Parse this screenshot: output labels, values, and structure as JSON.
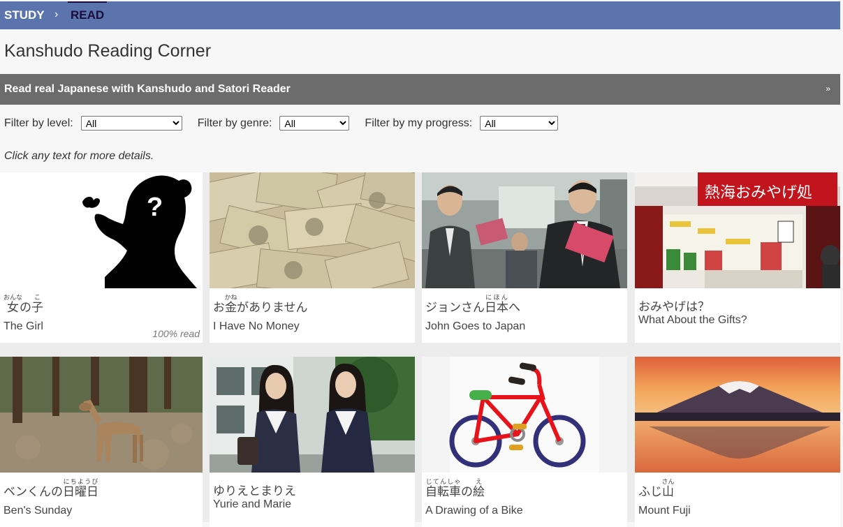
{
  "nav": {
    "study_label": "STUDY",
    "separator": "›",
    "read_label": "READ"
  },
  "page_title": "Kanshudo Reading Corner",
  "banner": {
    "title": "Read real Japanese with Kanshudo and Satori Reader",
    "chevron": "»"
  },
  "filters": {
    "level_label": "Filter by level:",
    "level_value": "All",
    "genre_label": "Filter by genre:",
    "genre_value": "All",
    "progress_label": "Filter by my progress:",
    "progress_value": "All"
  },
  "hint": "Click any text for more details.",
  "cards": [
    {
      "jp": [
        {
          "t": "女",
          "r": "おんな"
        },
        {
          "t": "の"
        },
        {
          "t": "子",
          "r": "こ"
        }
      ],
      "en": "The Girl",
      "progress": "100% read",
      "image_icon": "silhouette-question-image"
    },
    {
      "jp": [
        {
          "t": "お"
        },
        {
          "t": "金",
          "r": "かね"
        },
        {
          "t": "がありません"
        }
      ],
      "en": "I Have No Money",
      "image_icon": "yen-banknotes-image"
    },
    {
      "jp": [
        {
          "t": "ジョンさん"
        },
        {
          "t": "日本",
          "r": "にほん"
        },
        {
          "t": "へ"
        }
      ],
      "en": "John Goes to Japan",
      "image_icon": "train-passengers-image"
    },
    {
      "jp": [
        {
          "t": "おみやげは？"
        }
      ],
      "en": "What About the Gifts?",
      "image_icon": "souvenir-shop-image",
      "sign_text": "熱海おみやげ処"
    },
    {
      "jp": [
        {
          "t": "ベンくんの"
        },
        {
          "t": "日曜日",
          "r": "にちようび"
        }
      ],
      "en": "Ben's Sunday",
      "image_icon": "deer-forest-image"
    },
    {
      "jp": [
        {
          "t": "ゆりえとまりえ"
        }
      ],
      "en": "Yurie and Marie",
      "image_icon": "schoolgirls-image"
    },
    {
      "jp": [
        {
          "t": "自転車",
          "r": "じてんしゃ"
        },
        {
          "t": "の"
        },
        {
          "t": "絵",
          "r": "え"
        }
      ],
      "en": "A Drawing of a Bike",
      "image_icon": "bicycle-drawing-image"
    },
    {
      "jp": [
        {
          "t": "ふじ"
        },
        {
          "t": "山",
          "r": "さん"
        }
      ],
      "en": "Mount Fuji",
      "image_icon": "mount-fuji-image"
    }
  ],
  "colors": {
    "nav_bg": "#5b74ae",
    "banner_bg": "#6c6c6c",
    "read_accent": "#1a0d3a"
  }
}
